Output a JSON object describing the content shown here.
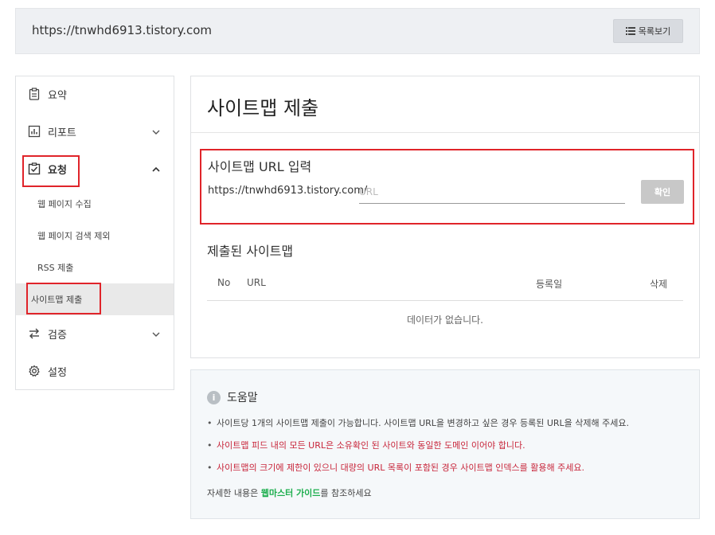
{
  "topbar": {
    "site_url": "https://tnwhd6913.tistory.com",
    "list_button_label": "목록보기"
  },
  "sidebar": {
    "items": [
      {
        "label": "요약",
        "icon": "clipboard-icon"
      },
      {
        "label": "리포트",
        "icon": "bar-chart-icon",
        "chevron": "down"
      },
      {
        "label": "요청",
        "icon": "checkbox-icon",
        "chevron": "up"
      },
      {
        "label": "검증",
        "icon": "swap-arrows-icon",
        "chevron": "down"
      },
      {
        "label": "설정",
        "icon": "gear-icon"
      }
    ],
    "sub_items": [
      {
        "label": "웹 페이지 수집"
      },
      {
        "label": "웹 페이지 검색 제외"
      },
      {
        "label": "RSS 제출"
      },
      {
        "label": "사이트맵 제출"
      }
    ]
  },
  "main": {
    "title": "사이트맵 제출",
    "url_section": {
      "title": "사이트맵 URL 입력",
      "prefix": "https://tnwhd6913.tistory.com/",
      "input_placeholder": "URL",
      "input_value": "",
      "confirm_label": "확인"
    },
    "submitted": {
      "title": "제출된 사이트맵",
      "columns": [
        "No",
        "URL",
        "등록일",
        "삭제"
      ],
      "empty_text": "데이터가 없습니다."
    }
  },
  "help": {
    "title": "도움말",
    "info_icon_glyph": "i",
    "items": [
      "사이트당 1개의 사이트맵 제출이 가능합니다. 사이트맵 URL을 변경하고 싶은 경우 등록된 URL을 삭제해 주세요.",
      "사이트맵 피드 내의 모든 URL은 소유확인 된 사이트와 동일한 도메인 이어야 합니다.",
      "사이트맵의 크기에 제한이 있으니 대량의 URL 목록이 포함된 경우 사이트맵 인덱스를 활용해 주세요."
    ],
    "footer_prefix": "자세한 내용은 ",
    "footer_link": "웹마스터 가이드",
    "footer_suffix": "를 참조하세요"
  },
  "colors": {
    "highlight_red": "#e0242a",
    "help_red_text": "#c8263b",
    "link_green": "#1dae4e"
  }
}
